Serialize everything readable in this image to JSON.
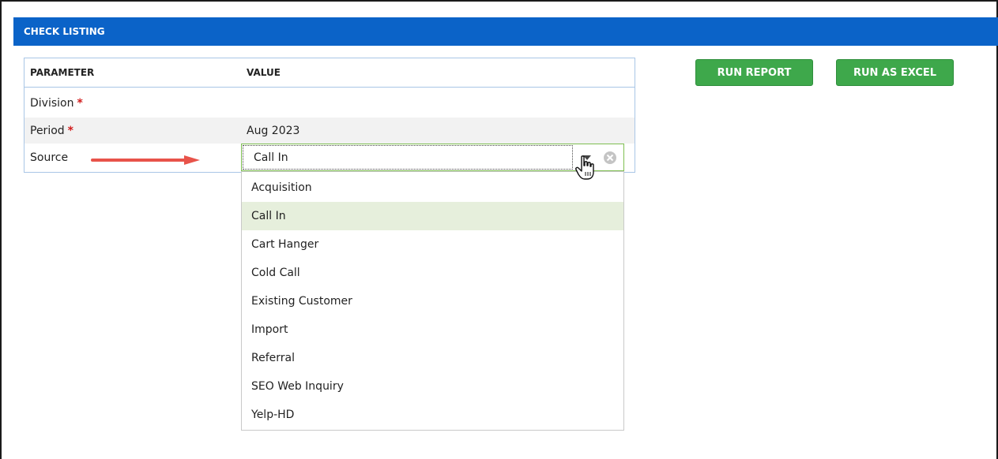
{
  "header": {
    "title": "CHECK LISTING"
  },
  "table": {
    "columns": {
      "parameter": "PARAMETER",
      "value": "VALUE"
    },
    "rows": [
      {
        "parameter": "Division",
        "required": "*",
        "value": ""
      },
      {
        "parameter": "Period",
        "required": "*",
        "value": "Aug 2023"
      },
      {
        "parameter": "Source",
        "required": "",
        "value": "Call In"
      }
    ]
  },
  "source_combo": {
    "selected": "Call In",
    "options": [
      "Acquisition",
      "Call In",
      "Cart Hanger",
      "Cold Call",
      "Existing Customer",
      "Import",
      "Referral",
      "SEO Web Inquiry",
      "Yelp-HD"
    ],
    "selected_index": 1
  },
  "buttons": {
    "run_report": "RUN REPORT",
    "run_excel": "RUN AS EXCEL"
  },
  "colors": {
    "header_bg": "#0b63c8",
    "button_bg": "#3ea84b",
    "required": "#d11b1b",
    "annotation_arrow": "#e8534a",
    "selected_option_bg": "#e6efdc",
    "combo_focus_border": "#7fbf52"
  },
  "icons": {
    "toggle": "chevron-down-icon",
    "clear": "clear-circle-icon",
    "cursor": "hand-pointer-icon",
    "annotation": "arrow-right-icon"
  }
}
